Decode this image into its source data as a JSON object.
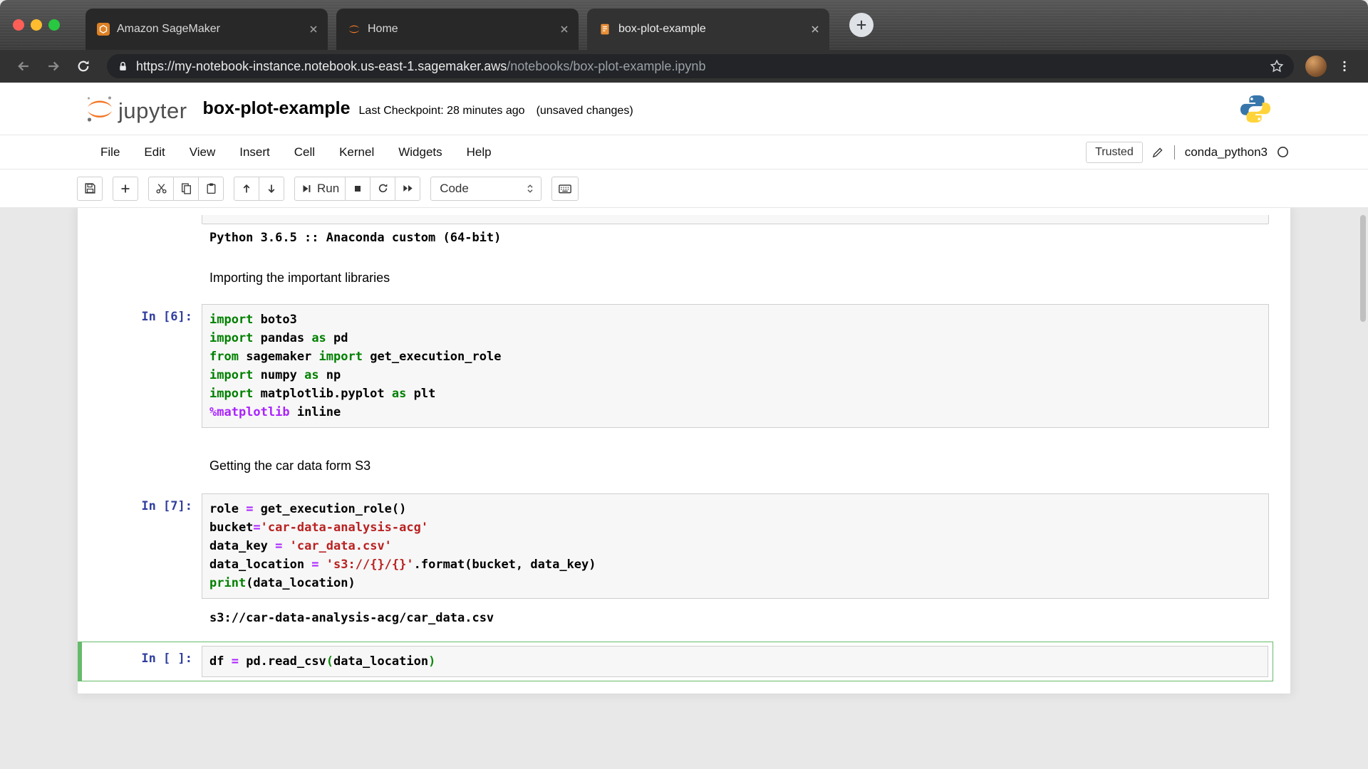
{
  "browser": {
    "tabs": [
      {
        "title": "Amazon SageMaker"
      },
      {
        "title": "Home"
      },
      {
        "title": "box-plot-example"
      }
    ],
    "url": {
      "host": "https://my-notebook-instance.notebook.us-east-1.sagemaker.aws",
      "path": "/notebooks/box-plot-example.ipynb"
    },
    "traffic_colors": {
      "close": "#ff5f57",
      "minimize": "#febc2e",
      "zoom": "#28c840"
    }
  },
  "header": {
    "logo_text": "jupyter",
    "title": "box-plot-example",
    "checkpoint": "Last Checkpoint: 28 minutes ago",
    "unsaved": "(unsaved changes)"
  },
  "menubar": {
    "items": [
      "File",
      "Edit",
      "View",
      "Insert",
      "Cell",
      "Kernel",
      "Widgets",
      "Help"
    ],
    "trusted_label": "Trusted",
    "kernel_name": "conda_python3"
  },
  "toolbar": {
    "run_label": "Run",
    "cell_type": "Code"
  },
  "colors": {
    "jupyter_orange": "#f37726",
    "prompt_blue": "#303f9f",
    "selected_green": "#66bb6a",
    "keyword_green": "#008000",
    "string_red": "#ba2121",
    "operator_purple": "#aa22ff"
  },
  "notebook": {
    "cells": [
      {
        "kind": "output",
        "text": "Python 3.6.5 :: Anaconda custom (64-bit)",
        "row_class": "row-output1"
      },
      {
        "kind": "markdown",
        "text": "Importing the important libraries",
        "row_class": "row-md1"
      },
      {
        "kind": "code",
        "prompt": "In [6]:",
        "row_class": "row-code6",
        "lines": [
          [
            [
              "kw",
              "import"
            ],
            [
              "pl",
              " boto3"
            ]
          ],
          [
            [
              "kw",
              "import"
            ],
            [
              "pl",
              " pandas "
            ],
            [
              "kw",
              "as"
            ],
            [
              "pl",
              " pd"
            ]
          ],
          [
            [
              "kw",
              "from"
            ],
            [
              "pl",
              " sagemaker "
            ],
            [
              "kw",
              "import"
            ],
            [
              "pl",
              " get_execution_role"
            ]
          ],
          [
            [
              "kw",
              "import"
            ],
            [
              "pl",
              " numpy "
            ],
            [
              "kw",
              "as"
            ],
            [
              "pl",
              " np"
            ]
          ],
          [
            [
              "kw",
              "import"
            ],
            [
              "pl",
              " matplotlib.pyplot "
            ],
            [
              "kw",
              "as"
            ],
            [
              "pl",
              " plt"
            ]
          ],
          [
            [
              "mg",
              "%matplotlib"
            ],
            [
              "pl",
              " inline"
            ]
          ]
        ]
      },
      {
        "kind": "markdown",
        "text": "Getting the car data form S3",
        "row_class": "row-md2"
      },
      {
        "kind": "code",
        "prompt": "In [7]:",
        "row_class": "row-code7",
        "lines": [
          [
            [
              "pl",
              "role "
            ],
            [
              "op",
              "="
            ],
            [
              "pl",
              " get_execution_role()"
            ]
          ],
          [
            [
              "pl",
              "bucket"
            ],
            [
              "op",
              "="
            ],
            [
              "st",
              "'car-data-analysis-acg'"
            ]
          ],
          [
            [
              "pl",
              "data_key "
            ],
            [
              "op",
              "="
            ],
            [
              "pl",
              " "
            ],
            [
              "st",
              "'car_data.csv'"
            ]
          ],
          [
            [
              "pl",
              "data_location "
            ],
            [
              "op",
              "="
            ],
            [
              "pl",
              " "
            ],
            [
              "st",
              "'s3://{}/{}'"
            ],
            [
              "pl",
              ".format(bucket, data_key)"
            ]
          ],
          [
            [
              "bi",
              "print"
            ],
            [
              "pl",
              "(data_location)"
            ]
          ]
        ]
      },
      {
        "kind": "output",
        "text": "s3://car-data-analysis-acg/car_data.csv",
        "row_class": "row-output2"
      },
      {
        "kind": "code",
        "prompt": "In [ ]:",
        "selected": true,
        "row_class": "row-sel",
        "lines": [
          [
            [
              "pl",
              "df "
            ],
            [
              "op",
              "="
            ],
            [
              "pl",
              " pd.read_csv"
            ],
            [
              "mb",
              "("
            ],
            [
              "pl",
              "data_location"
            ],
            [
              "mb",
              ")"
            ]
          ]
        ]
      }
    ]
  }
}
